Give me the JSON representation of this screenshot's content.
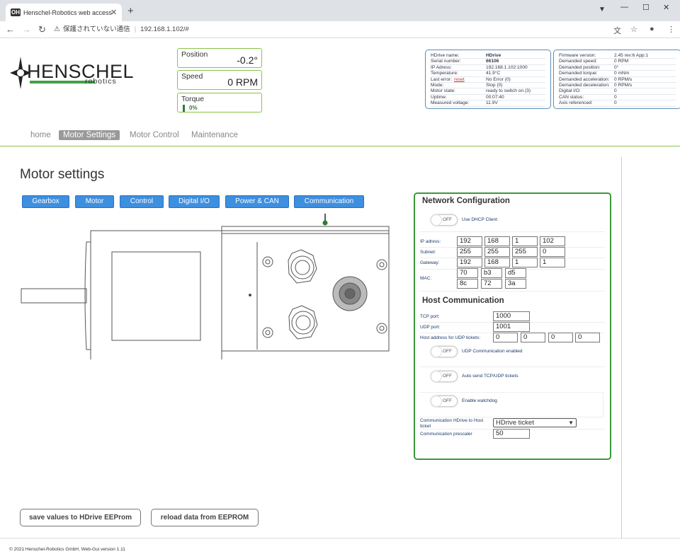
{
  "browser": {
    "tab_title": "Henschel-Robotics web access",
    "favicon_text": "OH",
    "new_tab": "+",
    "security_text": "保護されていない通信",
    "url": "192.168.1.102/#"
  },
  "logo": {
    "name": "HENSCHEL",
    "sub": "robotics"
  },
  "status": {
    "position": {
      "label": "Position",
      "value": "-0.2°"
    },
    "speed": {
      "label": "Speed",
      "value": "0 RPM"
    },
    "torque": {
      "label": "Torque",
      "value": "0%"
    }
  },
  "info_left": [
    {
      "k": "HDrive name:",
      "v": "HDrive",
      "bold": true
    },
    {
      "k": "Serial number:",
      "v": "66106",
      "bold": true
    },
    {
      "k": "IP Adress:",
      "v": "192.168.1.102:1000"
    },
    {
      "k": "Temperature:",
      "v": "41.9°C"
    },
    {
      "k": "Last error:",
      "v": "No Error (0)",
      "link": "reset"
    },
    {
      "k": "Mode:",
      "v": "Stop (0)"
    },
    {
      "k": "Motor state:",
      "v": "ready to switch on (3)"
    },
    {
      "k": "Uptime:",
      "v": "00:07:40"
    },
    {
      "k": "Measured voltage:",
      "v": "11.9V"
    }
  ],
  "info_right": [
    {
      "k": "Firmware version:",
      "v": "2.45 rev:6 App:1"
    },
    {
      "k": "Demanded speed:",
      "v": "0 RPM"
    },
    {
      "k": "Demanded position:",
      "v": "0°"
    },
    {
      "k": "Demanded torque:",
      "v": "0 mNm"
    },
    {
      "k": "Demanded acceleration:",
      "v": "0 RPM/s"
    },
    {
      "k": "Demanded deceleration:",
      "v": "0 RPM/s"
    },
    {
      "k": "Digital I/O:",
      "v": "0"
    },
    {
      "k": "CAN status:",
      "v": "0"
    },
    {
      "k": "Axis referenced:",
      "v": "0"
    }
  ],
  "nav": [
    "home",
    "Motor Settings",
    "Motor Control",
    "Maintenance"
  ],
  "nav_active": 1,
  "page_title": "Motor settings",
  "setting_tabs": [
    "Gearbox",
    "Motor",
    "Control",
    "Digital I/O",
    "Power & CAN",
    "Communication"
  ],
  "network": {
    "title": "Network Configuration",
    "dhcp_toggle": "OFF",
    "dhcp_label": "Use DHCP Client",
    "ip_label": "IP adress:",
    "ip": [
      "192",
      "168",
      "1",
      "102"
    ],
    "subnet_label": "Subnet:",
    "subnet": [
      "255",
      "255",
      "255",
      "0"
    ],
    "gateway_label": "Gateway:",
    "gateway": [
      "192",
      "168",
      "1",
      "1"
    ],
    "mac_label": "MAC:",
    "mac": [
      "70",
      "b3",
      "d5",
      "8c",
      "72",
      "3a"
    ]
  },
  "host": {
    "title": "Host Communication",
    "tcp_label": "TCP port:",
    "tcp": "1000",
    "udp_label": "UDP port:",
    "udp": "1001",
    "udp_addr_label": "Host address for UDP tickets:",
    "udp_addr": [
      "0",
      "0",
      "0",
      "0"
    ],
    "udp_enabled_toggle": "OFF",
    "udp_enabled_label": "UDP Communication enabled",
    "auto_send_toggle": "OFF",
    "auto_send_label": "Auto send TCP/UDP tickets",
    "watchdog_toggle": "OFF",
    "watchdog_label": "Enable watchdog",
    "comm_label": "Communication HDrive to Host ticket",
    "comm_value": "HDrive ticket",
    "prescaler_label": "Communication prescaler",
    "prescaler": "50"
  },
  "buttons": {
    "save": "save values to HDrive EEProm",
    "reload": "reload data from EEPROM"
  },
  "footer": "© 2021 Henschel-Robotics GmbH, Web-Gui version 1.11",
  "colors": {
    "accent": "#3d8fe0",
    "green": "#3a9a3a",
    "border_blue": "#5b8db8"
  }
}
